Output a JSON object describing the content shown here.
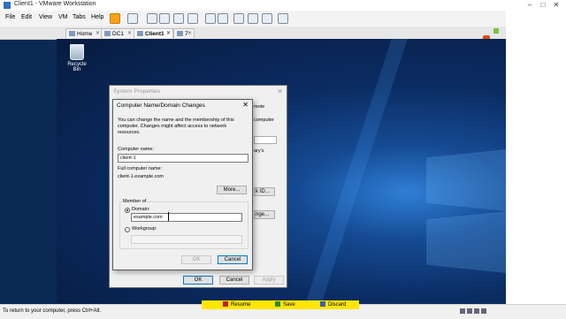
{
  "window": {
    "title": "Client1 - VMware Workstation",
    "minimize": "–",
    "maximize": "□",
    "close": "✕"
  },
  "menu": [
    "File",
    "Edit",
    "View",
    "VM",
    "Tabs",
    "Help"
  ],
  "tabs": [
    {
      "label": "Home"
    },
    {
      "label": "DC1"
    },
    {
      "label": "Client1"
    },
    {
      "label": "7"
    }
  ],
  "desktop": {
    "recycle_bin_label": "Recycle Bin"
  },
  "system_properties": {
    "title": "System Properties",
    "close": "✕",
    "fragments": {
      "mote": "mote",
      "computer": "computer",
      "arys": "ary's",
      "k_id": "k ID...",
      "nge": "nge..."
    },
    "ok": "OK",
    "cancel": "Cancel",
    "apply": "Apply"
  },
  "computer_name_dialog": {
    "title": "Computer Name/Domain Changes",
    "close": "✕",
    "description": "You can change the name and the membership of this computer. Changes might affect access to network resources.",
    "computer_name_label": "Computer name:",
    "computer_name_value": "client-1",
    "full_name_label": "Full computer name:",
    "full_name_value": "client-1.example.com",
    "more_button": "More...",
    "member_of_label": "Member of",
    "domain_label": "Domain:",
    "domain_value": "example.com",
    "workgroup_label": "Workgroup:",
    "workgroup_value": "",
    "ok": "OK",
    "cancel": "Cancel"
  },
  "status": {
    "text": "To return to your computer, press Ctrl+Alt."
  },
  "snapshot_bar": {
    "resume": "Resume",
    "save": "Save",
    "discard": "Discard"
  },
  "colors": {
    "accent": "#0078d7",
    "desktop": "#0b2c62",
    "snapshot_bar": "#ffe600"
  }
}
